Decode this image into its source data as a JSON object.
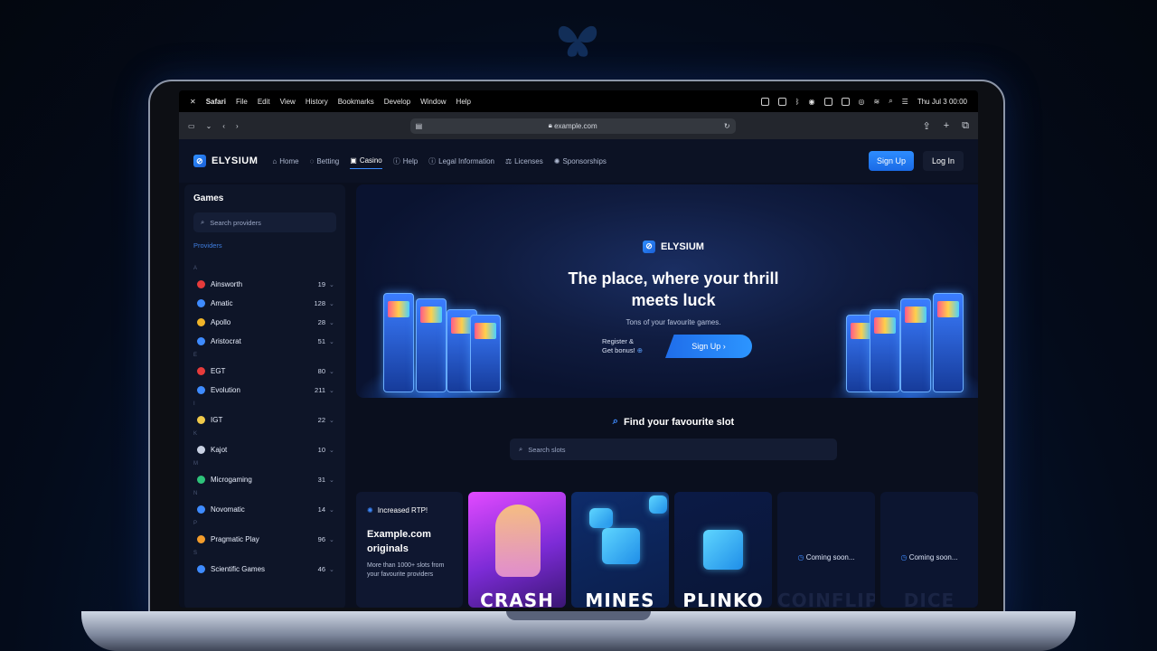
{
  "menubar": {
    "app": "Safari",
    "items": [
      "File",
      "Edit",
      "View",
      "History",
      "Bookmarks",
      "Develop",
      "Window",
      "Help"
    ],
    "datetime": "Thu Jul 3  00:00"
  },
  "browser": {
    "url": "example.com"
  },
  "site": {
    "brand": "ELYSIUM",
    "nav": [
      "Home",
      "Betting",
      "Casino",
      "Help",
      "Legal Information",
      "Licenses",
      "Sponsorships"
    ],
    "active_nav": "Casino",
    "signup": "Sign Up",
    "login": "Log In"
  },
  "sidebar": {
    "title": "Games",
    "search_placeholder": "Search providers",
    "providers_label": "Providers",
    "groups": [
      {
        "letter": "A",
        "items": [
          {
            "name": "Ainsworth",
            "count": "19",
            "color": "#e63b3b"
          },
          {
            "name": "Amatic",
            "count": "128",
            "color": "#3e8bff"
          },
          {
            "name": "Apollo",
            "count": "28",
            "color": "#f0b429"
          },
          {
            "name": "Aristocrat",
            "count": "51",
            "color": "#3e8bff"
          }
        ]
      },
      {
        "letter": "E",
        "items": [
          {
            "name": "EGT",
            "count": "80",
            "color": "#e63b3b"
          },
          {
            "name": "Evolution",
            "count": "211",
            "color": "#3e8bff"
          }
        ]
      },
      {
        "letter": "I",
        "items": [
          {
            "name": "IGT",
            "count": "22",
            "color": "#f0c94a"
          }
        ]
      },
      {
        "letter": "K",
        "items": [
          {
            "name": "Kajot",
            "count": "10",
            "color": "#c9d1e3"
          }
        ]
      },
      {
        "letter": "M",
        "items": [
          {
            "name": "Microgaming",
            "count": "31",
            "color": "#2ec37a"
          }
        ]
      },
      {
        "letter": "N",
        "items": [
          {
            "name": "Novomatic",
            "count": "14",
            "color": "#3e8bff"
          }
        ]
      },
      {
        "letter": "P",
        "items": [
          {
            "name": "Pragmatic Play",
            "count": "96",
            "color": "#f39c2b"
          }
        ]
      },
      {
        "letter": "S",
        "items": [
          {
            "name": "Scientific Games",
            "count": "46",
            "color": "#3e8bff"
          }
        ]
      }
    ]
  },
  "hero": {
    "brand": "ELYSIUM",
    "title": "The place, where your thrill meets luck",
    "subtitle": "Tons of your favourite games.",
    "register_line1": "Register &",
    "register_line2": "Get bonus!",
    "cta": "Sign Up"
  },
  "find": {
    "title": "Find your favourite slot",
    "placeholder": "Search slots"
  },
  "originals": {
    "badge": "Increased RTP!",
    "title": "Example.com originals",
    "desc": "More than 1000+ slots from your favourite providers"
  },
  "games": [
    {
      "name": "CRASH"
    },
    {
      "name": "MINES"
    },
    {
      "name": "PLINKO"
    },
    {
      "name": "COINFLIP",
      "status": "Coming soon..."
    },
    {
      "name": "DICE",
      "status": "Coming soon..."
    }
  ]
}
